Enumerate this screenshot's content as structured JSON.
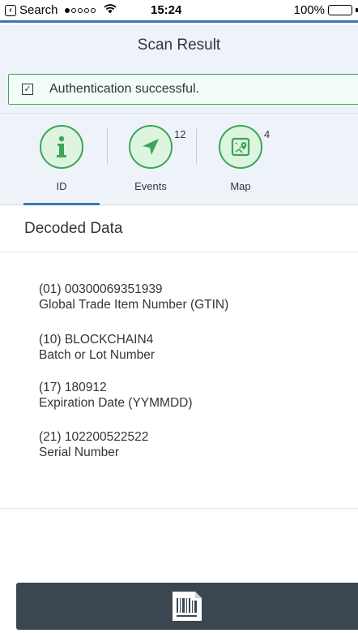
{
  "status_bar": {
    "back_app": "Search",
    "time": "15:24",
    "battery": "100%",
    "battery_level": 1.0,
    "signal_bars_filled": 1,
    "signal_bars_total": 5
  },
  "header": {
    "title": "Scan Result"
  },
  "message": {
    "text": "Authentication successful.",
    "type": "success"
  },
  "tabs": [
    {
      "label": "ID",
      "icon": "info-icon",
      "count": "",
      "selected": true
    },
    {
      "label": "Events",
      "icon": "navigation-arrow-icon",
      "count": "12",
      "selected": false
    },
    {
      "label": "Map",
      "icon": "map-icon",
      "count": "4",
      "selected": false
    }
  ],
  "section": {
    "title": "Decoded Data"
  },
  "decoded": [
    {
      "code": "(01) 00300069351939",
      "description": "Global Trade Item Number (GTIN)"
    },
    {
      "code": "(10) BLOCKCHAIN4",
      "description": "Batch or Lot Number"
    },
    {
      "code": "(17) 180912",
      "description": "Expiration Date (YYMMDD)"
    },
    {
      "code": "(21) 102200522522",
      "description": "Serial Number"
    }
  ],
  "footer": {
    "scan_icon": "barcode-scan-icon"
  },
  "colors": {
    "accent": "#3a78b5",
    "success": "#3fa45b",
    "header_bg": "#edf3f8",
    "footer_bg": "#3b4650"
  }
}
